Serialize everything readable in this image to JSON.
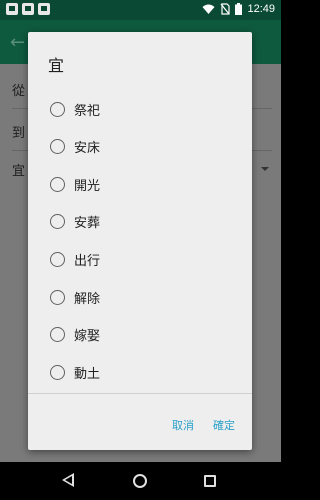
{
  "status_bar": {
    "time": "12:49",
    "icons": [
      "mail-icon",
      "gmail-icon",
      "upload-icon",
      "wifi-icon",
      "no-sim-icon",
      "battery-icon"
    ]
  },
  "background": {
    "from_label": "從",
    "to_label": "到",
    "type_label": "宜"
  },
  "dialog": {
    "title": "宜",
    "options": [
      {
        "label": "祭祀",
        "selected": false
      },
      {
        "label": "安床",
        "selected": false
      },
      {
        "label": "開光",
        "selected": false
      },
      {
        "label": "安葬",
        "selected": false
      },
      {
        "label": "出行",
        "selected": false
      },
      {
        "label": "解除",
        "selected": false
      },
      {
        "label": "嫁娶",
        "selected": false
      },
      {
        "label": "動土",
        "selected": false
      }
    ],
    "cancel_label": "取消",
    "confirm_label": "確定"
  },
  "colors": {
    "accent": "#2aa0c8",
    "toolbar": "#0e5a3f",
    "dialog_bg": "#eeeeee"
  }
}
